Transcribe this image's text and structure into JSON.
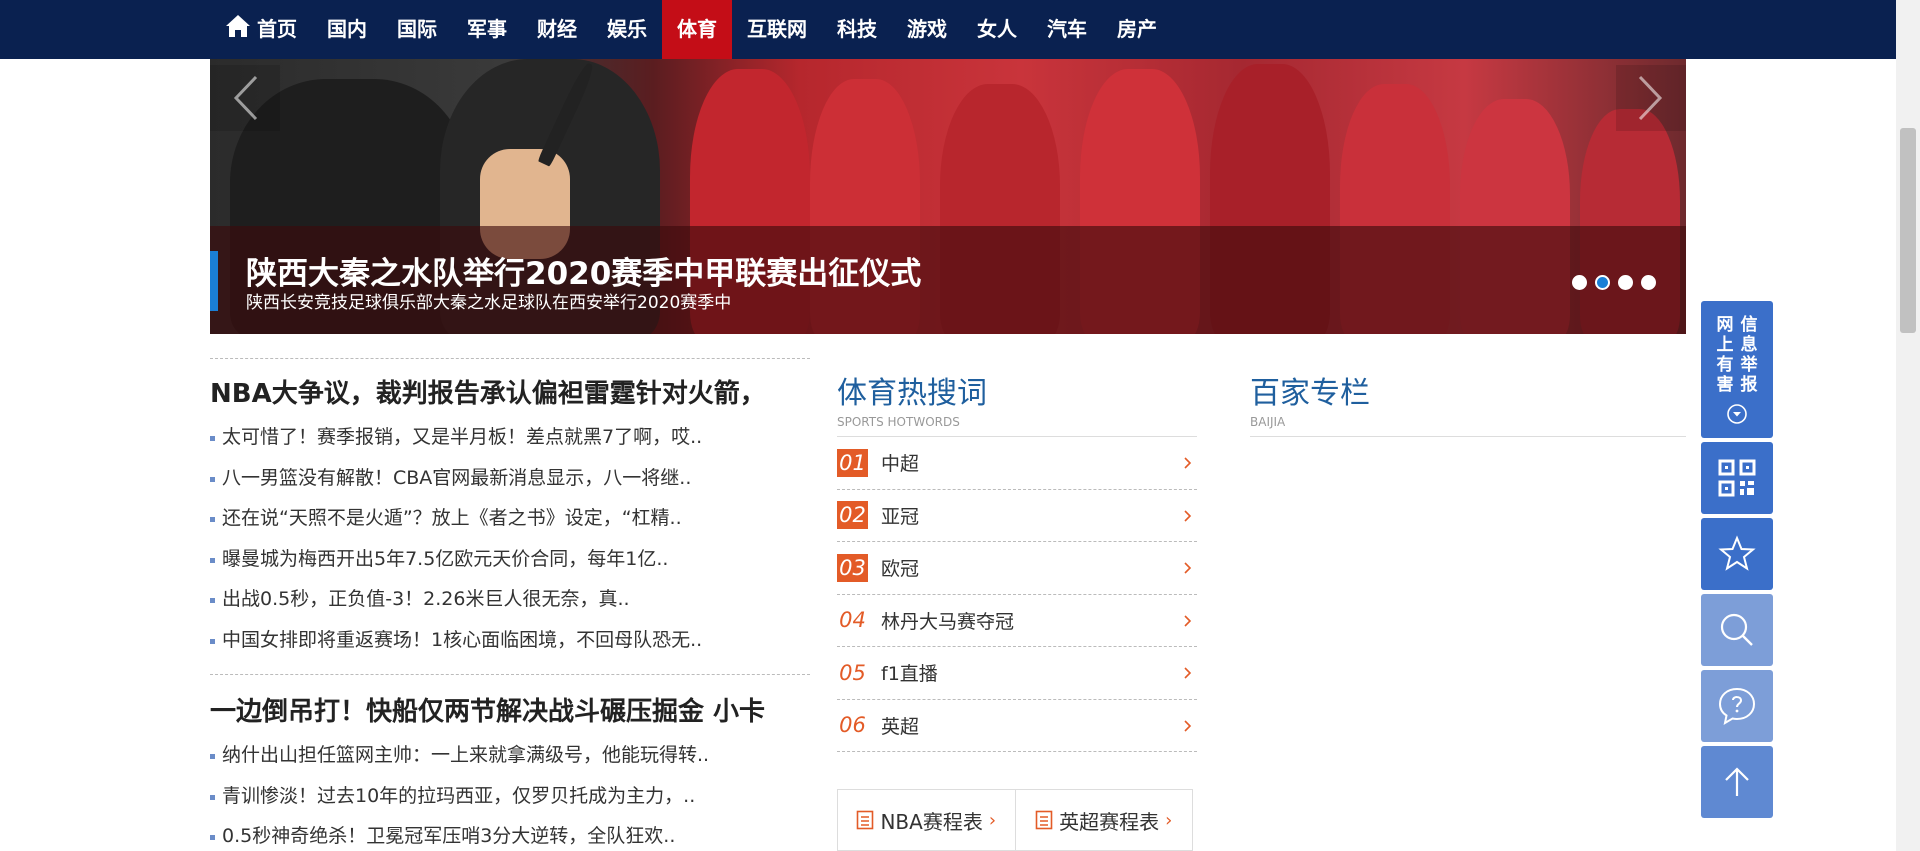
{
  "nav": {
    "home": "首页",
    "items": [
      "国内",
      "国际",
      "军事",
      "财经",
      "娱乐",
      "体育",
      "互联网",
      "科技",
      "游戏",
      "女人",
      "汽车",
      "房产"
    ],
    "active": "体育"
  },
  "banner": {
    "title": "陕西大秦之水队举行2020赛季中甲联赛出征仪式",
    "description": "陕西长安竞技足球俱乐部大秦之水足球队在西安举行2020赛季中",
    "slide_count": 4,
    "active_slide": 2
  },
  "news": {
    "groups": [
      {
        "headline": "NBA大争议，裁判报告承认偏袒雷霆针对火箭，",
        "items": [
          "太可惜了！赛季报销，又是半月板！差点就黑7了啊，哎..",
          "八一男篮没有解散！CBA官网最新消息显示，八一将继..",
          "还在说“天照不是火遁”？放上《者之书》设定，“杠精..",
          "曝曼城为梅西开出5年7.5亿欧元天价合同，每年1亿..",
          "出战0.5秒，正负值-3！2.26米巨人很无奈，真..",
          "中国女排即将重返赛场！1核心面临困境，不回母队恐无.."
        ]
      },
      {
        "headline": "一边倒吊打！快船仅两节解决战斗碾压掘金 小卡",
        "items": [
          "纳什出山担任篮网主帅：一上来就拿满级号，他能玩得转..",
          "青训惨淡！过去10年的拉玛西亚，仅罗贝托成为主力，..",
          "0.5秒神奇绝杀！卫冕冠军压哨3分大逆转，全队狂欢.."
        ]
      }
    ]
  },
  "hotwords": {
    "title": "体育热搜词",
    "subtitle": "SPORTS HOTWORDS",
    "items": [
      {
        "rank": "01",
        "label": "中超"
      },
      {
        "rank": "02",
        "label": "亚冠"
      },
      {
        "rank": "03",
        "label": "欧冠"
      },
      {
        "rank": "04",
        "label": "林丹大马赛夺冠"
      },
      {
        "rank": "05",
        "label": "f1直播"
      },
      {
        "rank": "06",
        "label": "英超"
      }
    ],
    "schedules": [
      "NBA赛程表",
      "英超赛程表"
    ]
  },
  "baijia": {
    "title": "百家专栏",
    "subtitle": "BAIJIA"
  },
  "float_bar": {
    "report_text": "网上有害信息举报",
    "report_col1": "网上有害",
    "report_col2": "信息举报"
  },
  "colors": {
    "nav_bg": "#0a2150",
    "nav_active": "#c40d17",
    "accent_blue": "#1f5f9e",
    "rank_orange": "#e35b27",
    "float_blue": "#3b6fc9"
  }
}
